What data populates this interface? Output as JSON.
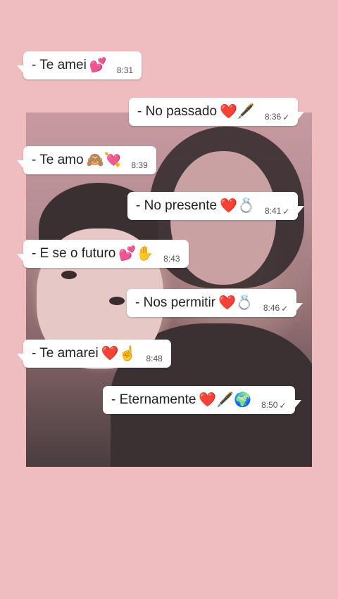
{
  "messages": [
    {
      "text": "- Te amei",
      "emojis": "💕",
      "time": "8:31",
      "dir": "in"
    },
    {
      "text": "- No passado",
      "emojis": "❤️🖋️",
      "time": "8:36",
      "dir": "out",
      "check": "✓"
    },
    {
      "text": "- Te amo",
      "emojis": "🙈💘",
      "time": "8:39",
      "dir": "in"
    },
    {
      "text": "- No presente",
      "emojis": "❤️💍",
      "time": "8:41",
      "dir": "out",
      "check": "✓"
    },
    {
      "text": "- E se o futuro",
      "emojis": "💕✋",
      "time": "8:43",
      "dir": "in"
    },
    {
      "text": "- Nos permitir",
      "emojis": "❤️💍",
      "time": "8:46",
      "dir": "out",
      "check": "✓"
    },
    {
      "text": "- Te amarei",
      "emojis": "❤️☝️",
      "time": "8:48",
      "dir": "in"
    },
    {
      "text": "- Eternamente",
      "emojis": "❤️🖋️🌍",
      "time": "8:50",
      "dir": "out",
      "check": "✓"
    }
  ],
  "colors": {
    "background": "#efbcc0",
    "bubble": "#ffffff"
  }
}
